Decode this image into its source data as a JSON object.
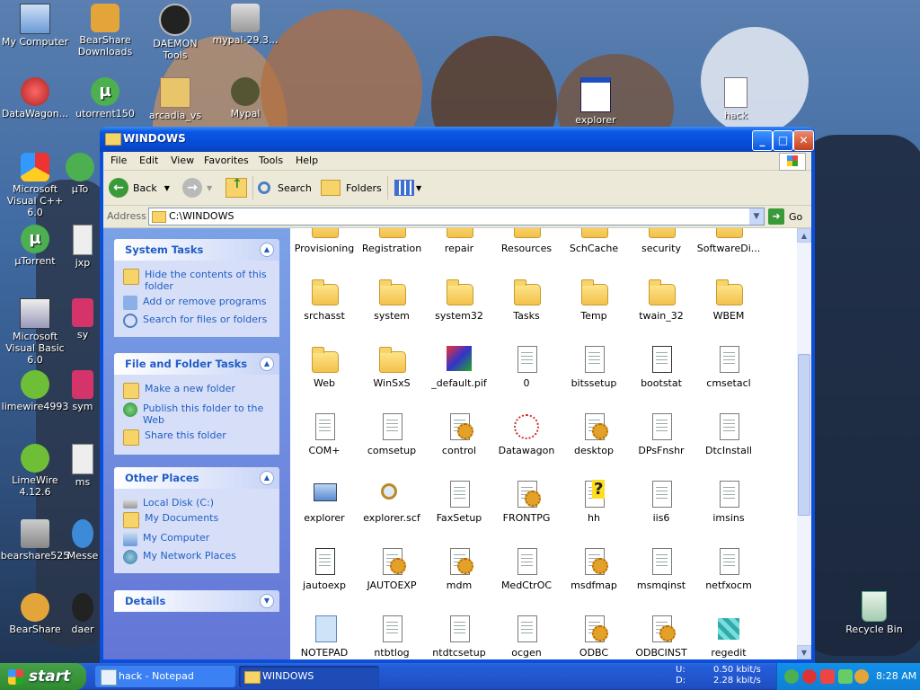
{
  "desktop": {
    "icons": [
      {
        "label": "My Computer"
      },
      {
        "label": "BearShare Downloads"
      },
      {
        "label": "DAEMON Tools"
      },
      {
        "label": "mypal-29.3..."
      },
      {
        "label": "DataWagon..."
      },
      {
        "label": "utorrent150"
      },
      {
        "label": "arcadia_vs"
      },
      {
        "label": "Mypal"
      },
      {
        "label": "explorer"
      },
      {
        "label": "hack"
      },
      {
        "label": "Microsoft Visual C++ 6.0"
      },
      {
        "label": "µTo"
      },
      {
        "label": "µTorrent"
      },
      {
        "label": "jxp"
      },
      {
        "label": "Microsoft Visual Basic 6.0"
      },
      {
        "label": "sy"
      },
      {
        "label": "limewire4993"
      },
      {
        "label": "sym"
      },
      {
        "label": "LimeWire 4.12.6"
      },
      {
        "label": "ms"
      },
      {
        "label": "bearshare525"
      },
      {
        "label": "Messe"
      },
      {
        "label": "BearShare"
      },
      {
        "label": "daer"
      },
      {
        "label": "Recycle Bin"
      }
    ]
  },
  "window": {
    "title": "WINDOWS",
    "menu": [
      "File",
      "Edit",
      "View",
      "Favorites",
      "Tools",
      "Help"
    ],
    "toolbar": {
      "back": "Back",
      "search": "Search",
      "folders": "Folders"
    },
    "address": {
      "label": "Address",
      "value": "C:\\WINDOWS",
      "go": "Go"
    },
    "panels": {
      "system_tasks": {
        "title": "System Tasks",
        "items": [
          "Hide the contents of this folder",
          "Add or remove programs",
          "Search for files or folders"
        ]
      },
      "file_tasks": {
        "title": "File and Folder Tasks",
        "items": [
          "Make a new folder",
          "Publish this folder to the Web",
          "Share this folder"
        ]
      },
      "other_places": {
        "title": "Other Places",
        "items": [
          "Local Disk (C:)",
          "My Documents",
          "My Computer",
          "My Network Places"
        ]
      },
      "details": {
        "title": "Details"
      }
    },
    "files": [
      {
        "name": "Provisioning",
        "type": "folder"
      },
      {
        "name": "Registration",
        "type": "folder"
      },
      {
        "name": "repair",
        "type": "folder"
      },
      {
        "name": "Resources",
        "type": "folder"
      },
      {
        "name": "SchCache",
        "type": "folder"
      },
      {
        "name": "security",
        "type": "folder"
      },
      {
        "name": "SoftwareDi...",
        "type": "folder"
      },
      {
        "name": "srchasst",
        "type": "folder"
      },
      {
        "name": "system",
        "type": "folder"
      },
      {
        "name": "system32",
        "type": "folder"
      },
      {
        "name": "Tasks",
        "type": "folder"
      },
      {
        "name": "Temp",
        "type": "folder"
      },
      {
        "name": "twain_32",
        "type": "folder"
      },
      {
        "name": "WBEM",
        "type": "folder"
      },
      {
        "name": "Web",
        "type": "folder"
      },
      {
        "name": "WinSxS",
        "type": "folder"
      },
      {
        "name": "_default.pif",
        "type": "pif"
      },
      {
        "name": "0",
        "type": "doc"
      },
      {
        "name": "bitssetup",
        "type": "doc"
      },
      {
        "name": "bootstat",
        "type": "dat"
      },
      {
        "name": "cmsetacl",
        "type": "doc"
      },
      {
        "name": "COM+",
        "type": "doc"
      },
      {
        "name": "comsetup",
        "type": "doc"
      },
      {
        "name": "control",
        "type": "gear"
      },
      {
        "name": "Datawagon",
        "type": "special"
      },
      {
        "name": "desktop",
        "type": "gear"
      },
      {
        "name": "DPsFnshr",
        "type": "doc"
      },
      {
        "name": "DtcInstall",
        "type": "doc"
      },
      {
        "name": "explorer",
        "type": "exe"
      },
      {
        "name": "explorer.scf",
        "type": "search"
      },
      {
        "name": "FaxSetup",
        "type": "doc"
      },
      {
        "name": "FRONTPG",
        "type": "gear"
      },
      {
        "name": "hh",
        "type": "help"
      },
      {
        "name": "iis6",
        "type": "doc"
      },
      {
        "name": "imsins",
        "type": "doc"
      },
      {
        "name": "jautoexp",
        "type": "dat"
      },
      {
        "name": "JAUTOEXP",
        "type": "gear"
      },
      {
        "name": "mdm",
        "type": "gear"
      },
      {
        "name": "MedCtrOC",
        "type": "doc"
      },
      {
        "name": "msdfmap",
        "type": "gear"
      },
      {
        "name": "msmqinst",
        "type": "doc"
      },
      {
        "name": "netfxocm",
        "type": "doc"
      },
      {
        "name": "NOTEPAD",
        "type": "notepad"
      },
      {
        "name": "ntbtlog",
        "type": "doc"
      },
      {
        "name": "ntdtcsetup",
        "type": "doc"
      },
      {
        "name": "ocgen",
        "type": "doc"
      },
      {
        "name": "ODBC",
        "type": "gear"
      },
      {
        "name": "ODBCINST",
        "type": "gear"
      },
      {
        "name": "regedit",
        "type": "regedit"
      }
    ]
  },
  "taskbar": {
    "start": "start",
    "tasks": [
      "hack - Notepad",
      "WINDOWS"
    ],
    "netspeed": {
      "u_label": "U:",
      "u_value": "0.50 kbit/s",
      "d_label": "D:",
      "d_value": "2.28 kbit/s"
    },
    "clock": "8:28 AM"
  },
  "colors": {
    "xp_blue": "#0a4fdb",
    "task_pane": "#6375d6",
    "link": "#215dc6",
    "start_green": "#2f8a2f"
  }
}
